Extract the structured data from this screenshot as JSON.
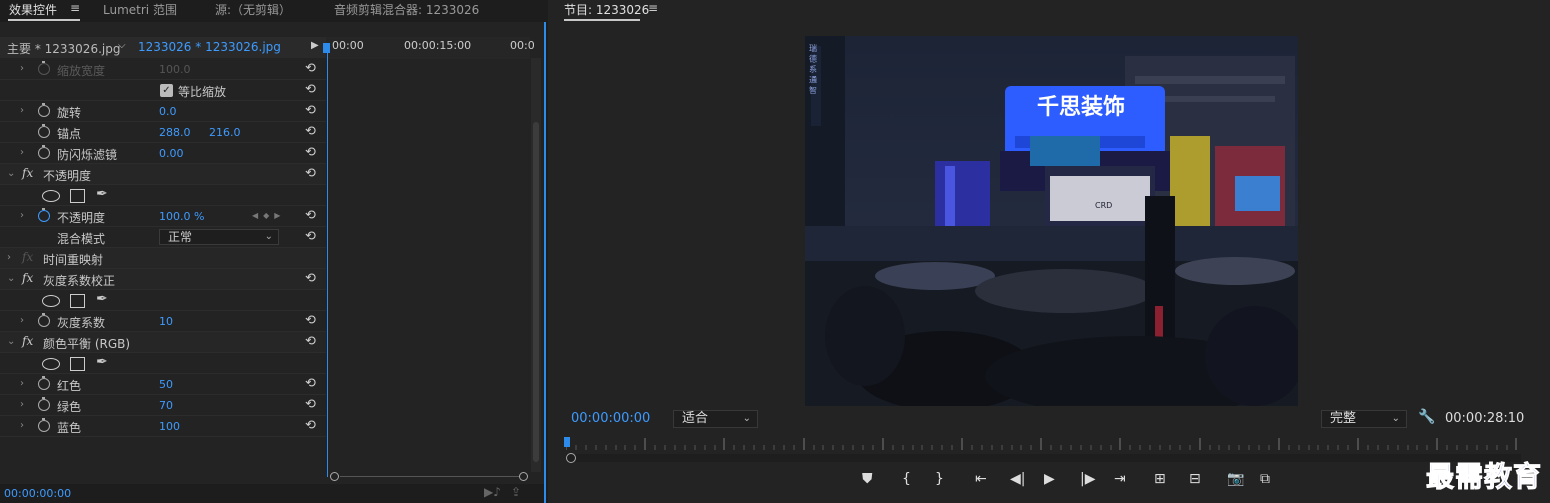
{
  "tabs": {
    "effect_controls": "效果控件",
    "menu_icon": "≡",
    "lumetri": "Lumetri 范围",
    "source": "源:（无剪辑）",
    "audio_mixer": "音频剪辑混合器: 1233026"
  },
  "sequence_bar": {
    "master": "主要 * 1233026.jpg",
    "clip": "1233026 * 1233026.jpg",
    "time_start": "00:00",
    "time_mid": "00:00:15:00",
    "time_end": "00:0"
  },
  "effects": {
    "scale_width": {
      "label": "缩放宽度",
      "value": "100.0"
    },
    "uniform_scale": {
      "label": "等比缩放",
      "check": "✓"
    },
    "rotation": {
      "label": "旋转",
      "value": "0.0"
    },
    "anchor": {
      "label": "锚点",
      "x": "288.0",
      "y": "216.0"
    },
    "anti_flicker": {
      "label": "防闪烁滤镜",
      "value": "0.00"
    },
    "opacity_section": {
      "label": "不透明度"
    },
    "opacity": {
      "label": "不透明度",
      "value": "100.0 %"
    },
    "blend_mode": {
      "label": "混合模式",
      "value": "正常"
    },
    "time_remap": {
      "label": "时间重映射"
    },
    "gamma_section": {
      "label": "灰度系数校正"
    },
    "gamma": {
      "label": "灰度系数",
      "value": "10"
    },
    "color_balance_section": {
      "label": "颜色平衡 (RGB)"
    },
    "red": {
      "label": "红色",
      "value": "50"
    },
    "green": {
      "label": "绿色",
      "value": "70"
    },
    "blue": {
      "label": "蓝色",
      "value": "100"
    },
    "fx": "fx",
    "reset_icon": "⟲"
  },
  "left_status": {
    "timecode": "00:00:00:00"
  },
  "program": {
    "title": "节目: 1233026",
    "menu_icon": "≡",
    "timecode": "00:00:00:00",
    "fit": "适合",
    "quality": "完整",
    "duration": "00:00:28:10",
    "video": {
      "vertical_sign": "瑞 德 系 通 智",
      "billboard": "千思装饰",
      "sign": "CRD"
    }
  },
  "watermark": "最需教育",
  "colors": {
    "accent": "#2d8ceb",
    "value_blue": "#3d9bff",
    "panel": "#232323"
  }
}
